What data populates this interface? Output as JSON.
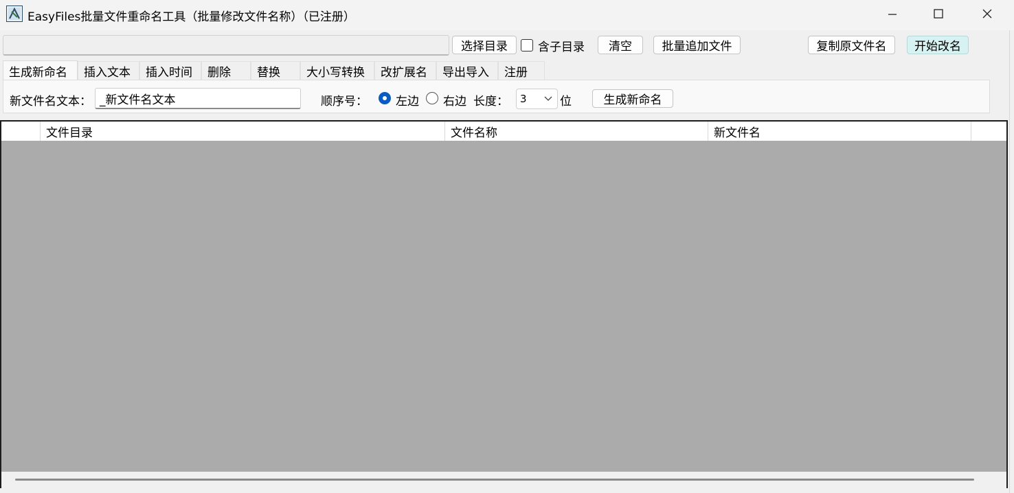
{
  "window": {
    "title": "EasyFiles批量文件重命名工具（批量修改文件名称）（已注册）",
    "minimize": "—",
    "maximize": "☐",
    "close": "✕"
  },
  "toolbar": {
    "path_value": "",
    "select_dir": "选择目录",
    "include_subdirs": "含子目录",
    "clear": "清空",
    "batch_add_files": "批量追加文件",
    "copy_original_name": "复制原文件名",
    "start_rename": "开始改名"
  },
  "tabs": [
    "生成新命名",
    "插入文本",
    "插入时间",
    "删除",
    "替换",
    "大小写转换",
    "改扩展名",
    "导出导入",
    "注册"
  ],
  "panel": {
    "new_name_label": "新文件名文本：",
    "new_name_value": "_新文件名文本",
    "seq_label": "顺序号：",
    "left_label": "左边",
    "right_label": "右边",
    "length_label": "长度：",
    "length_value": "3",
    "digits_label": "位",
    "generate_button": "生成新命名"
  },
  "grid": {
    "columns": [
      "",
      "文件目录",
      "文件名称",
      "新文件名"
    ]
  },
  "colors": {
    "accent_button": "#d7f2f2",
    "grid_background": "#ababab",
    "radio_selected": "#0b5cc1"
  }
}
